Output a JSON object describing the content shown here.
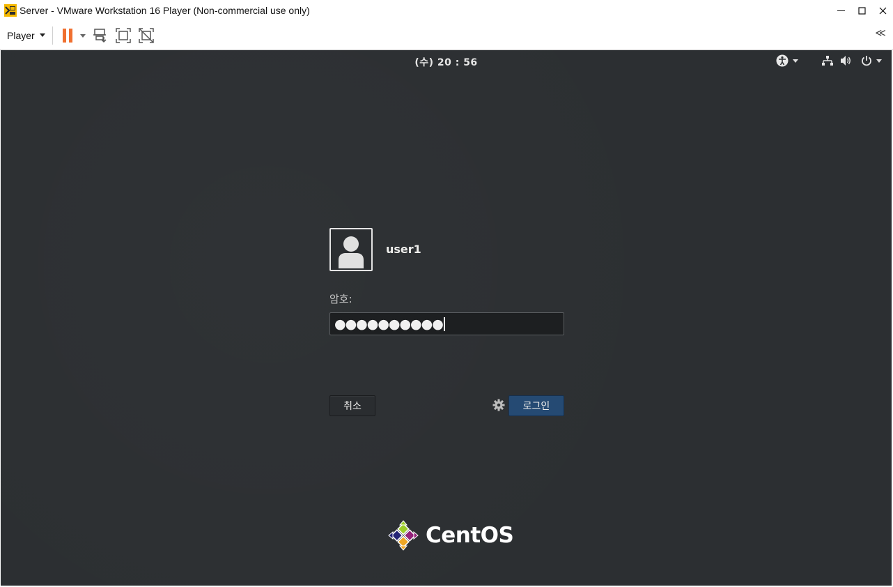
{
  "window": {
    "title": "Server - VMware Workstation 16 Player (Non-commercial use only)",
    "controls": {
      "minimize": "—",
      "maximize": "☐",
      "close": "✕"
    }
  },
  "toolbar": {
    "player_menu_label": "Player",
    "icons": [
      "pause-icon",
      "send-ctrl-alt-del-icon",
      "full-screen-icon",
      "unity-icon"
    ],
    "collapse_label": "≪"
  },
  "vm": {
    "clock": "(수) 20 : 56",
    "status_icons": [
      "accessibility-icon",
      "network-icon",
      "volume-icon",
      "power-icon"
    ],
    "login": {
      "username": "user1",
      "password_label": "암호:",
      "password_masked": "●●●●●●●●●●",
      "cancel_label": "취소",
      "login_label": "로그인"
    },
    "brand": "CentOS"
  },
  "colors": {
    "screen_bg": "#2c2f32",
    "login_button": "#254a73",
    "pause_accent": "#f07030",
    "vmware_yellow": "#f5b800"
  }
}
